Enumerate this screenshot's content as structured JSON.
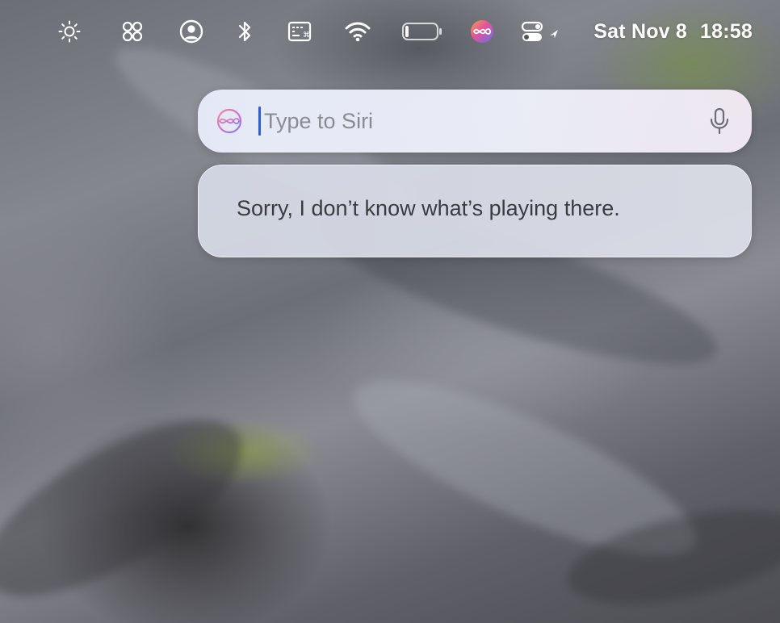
{
  "menubar": {
    "icons": [
      "brightness-icon",
      "stage-manager-icon",
      "user-account-icon",
      "bluetooth-icon",
      "keyboard-input-icon",
      "wifi-icon",
      "battery-icon",
      "siri-icon",
      "control-center-icon"
    ],
    "date": "Sat Nov 8",
    "time": "18:58"
  },
  "siri": {
    "input_placeholder": "Type to Siri",
    "input_value": "",
    "response": "Sorry, I don’t know what’s playing there."
  },
  "colors": {
    "caret": "#2f5dd8",
    "menubar_text": "#ffffff",
    "response_text": "#3a3b3f"
  }
}
